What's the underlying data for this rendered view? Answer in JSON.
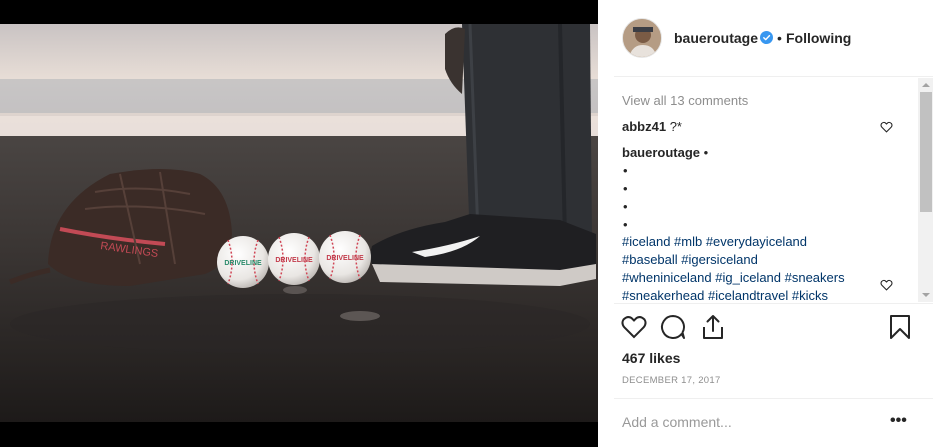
{
  "post": {
    "username": "baueroutage",
    "dot": "•",
    "follow_state": "Following"
  },
  "comments": {
    "view_all": "View all 13 comments",
    "items": [
      {
        "user": "abbz41",
        "text": "?*"
      },
      {
        "user": "baueroutage",
        "text": "•"
      }
    ],
    "bullets": [
      "•",
      "•",
      "•",
      "•"
    ],
    "hashtag_lines": [
      "#iceland #mlb #everydayiceland",
      "#baseball #igersiceland",
      "#wheniniceland #ig_iceland #sneakers",
      "#sneakerhead #icelandtravel #kicks"
    ]
  },
  "engagement": {
    "likes": "467 likes",
    "date": "DECEMBER 17, 2017"
  },
  "composer": {
    "placeholder": "Add a comment...",
    "more": "•••"
  },
  "photo": {
    "ball_logo": "DRIVELINE"
  },
  "icons": [
    "verified-badge-icon",
    "heart-icon",
    "comment-icon",
    "share-icon",
    "bookmark-icon",
    "more-options-icon"
  ],
  "colors": {
    "link": "#003569",
    "muted": "#8e8e8e",
    "verified": "#3897f0",
    "text": "#262626"
  }
}
